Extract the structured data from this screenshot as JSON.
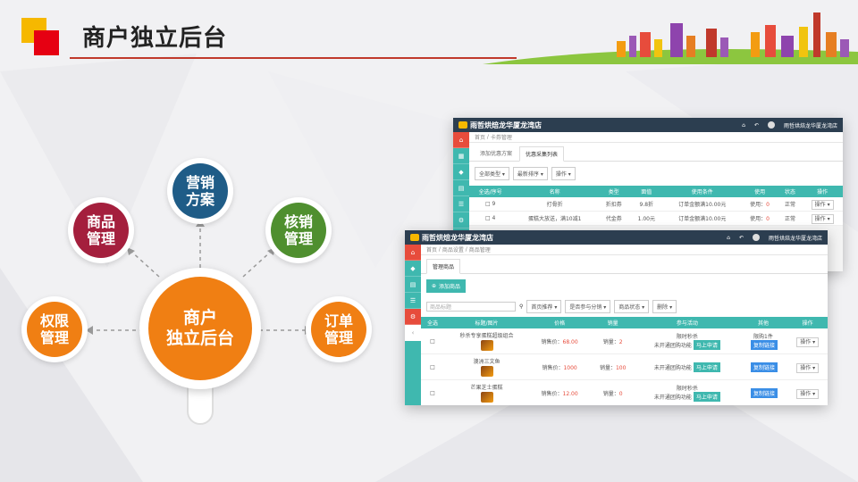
{
  "title": "商户独立后台",
  "diagram": {
    "center": {
      "line1": "商户",
      "line2": "独立后台",
      "color": "#f07f13"
    },
    "nodes": [
      {
        "id": "marketing",
        "line1": "营销",
        "line2": "方案",
        "color": "#1f5c87"
      },
      {
        "id": "goods",
        "line1": "商品",
        "line2": "管理",
        "color": "#a41f3d"
      },
      {
        "id": "verify",
        "line1": "核销",
        "line2": "管理",
        "color": "#4f8f2f"
      },
      {
        "id": "permission",
        "line1": "权限",
        "line2": "管理",
        "color": "#f07f13"
      },
      {
        "id": "order",
        "line1": "订单",
        "line2": "管理",
        "color": "#f07f13"
      }
    ]
  },
  "back_shot": {
    "brand": "雨哲烘焙龙华厦龙湾店",
    "user": "雨哲烘焙龙华厦龙湾店",
    "crumb": [
      "首页",
      "卡券管理"
    ],
    "tabs": [
      "添加优惠方案",
      "优惠采集列表"
    ],
    "filters": [
      "全部类型 ▾",
      "最新排序 ▾",
      "操作 ▾"
    ],
    "columns": [
      "全选/序号",
      "名称",
      "类型",
      "面值",
      "使用条件",
      "使用",
      "状态",
      "操作"
    ],
    "rows": [
      {
        "no": "9",
        "name": "打骨折",
        "type": "折扣券",
        "value": "9.8折",
        "condition": "订单金额满10.00元",
        "use": "使用：",
        "use_n": "0",
        "status": "正常",
        "op": "操作 ▾"
      },
      {
        "no": "4",
        "name": "蛋糕大放送，满10减1",
        "type": "代金券",
        "value": "1.00元",
        "condition": "订单金额满10.00元",
        "use": "使用：",
        "use_n": "0",
        "status": "正常",
        "op": "操作 ▾"
      }
    ]
  },
  "front_shot": {
    "brand": "雨哲烘焙龙华厦龙湾店",
    "user": "雨哲烘焙龙华厦龙湾店",
    "crumb": [
      "首页",
      "商品设置",
      "商品管理"
    ],
    "tab": "管理商品",
    "add_button": "添加商品",
    "search_placeholder": "商品标题",
    "filters": [
      "首页推荐 ▾",
      "是否参与分销 ▾",
      "商品状态 ▾",
      "删除 ▾"
    ],
    "columns": [
      "全选",
      "标题/图片",
      "价格",
      "销量",
      "参与活动",
      "其他",
      "操作"
    ],
    "rows": [
      {
        "title": "秒杀专享蛋糕超级组合",
        "price_label": "销售价：",
        "price": "68.00",
        "sales_label": "销量：",
        "sales": "2",
        "act1": "限时秒杀",
        "act2": "未开通团购功能",
        "badge": "马上申请",
        "other1": "限购1件",
        "other2": "复制链接",
        "op": "操作 ▾"
      },
      {
        "title": "澳洲三文鱼",
        "price_label": "销售价：",
        "price": "1000",
        "sales_label": "销量：",
        "sales": "100",
        "act1": "",
        "act2": "未开通团购功能",
        "badge": "马上申请",
        "other1": "",
        "other2": "复制链接",
        "op": "操作 ▾"
      },
      {
        "title": "芒果芝士蛋糕",
        "price_label": "销售价：",
        "price": "12.00",
        "sales_label": "销量：",
        "sales": "0",
        "act1": "限时秒杀",
        "act2": "未开通团购功能",
        "badge": "马上申请",
        "other1": "",
        "other2": "复制链接",
        "op": "操作 ▾"
      }
    ]
  },
  "colors": {
    "teal": "#3fb8af",
    "dark": "#2c3e50",
    "accent": "#e74c3c",
    "link": "#3a8ee6"
  }
}
